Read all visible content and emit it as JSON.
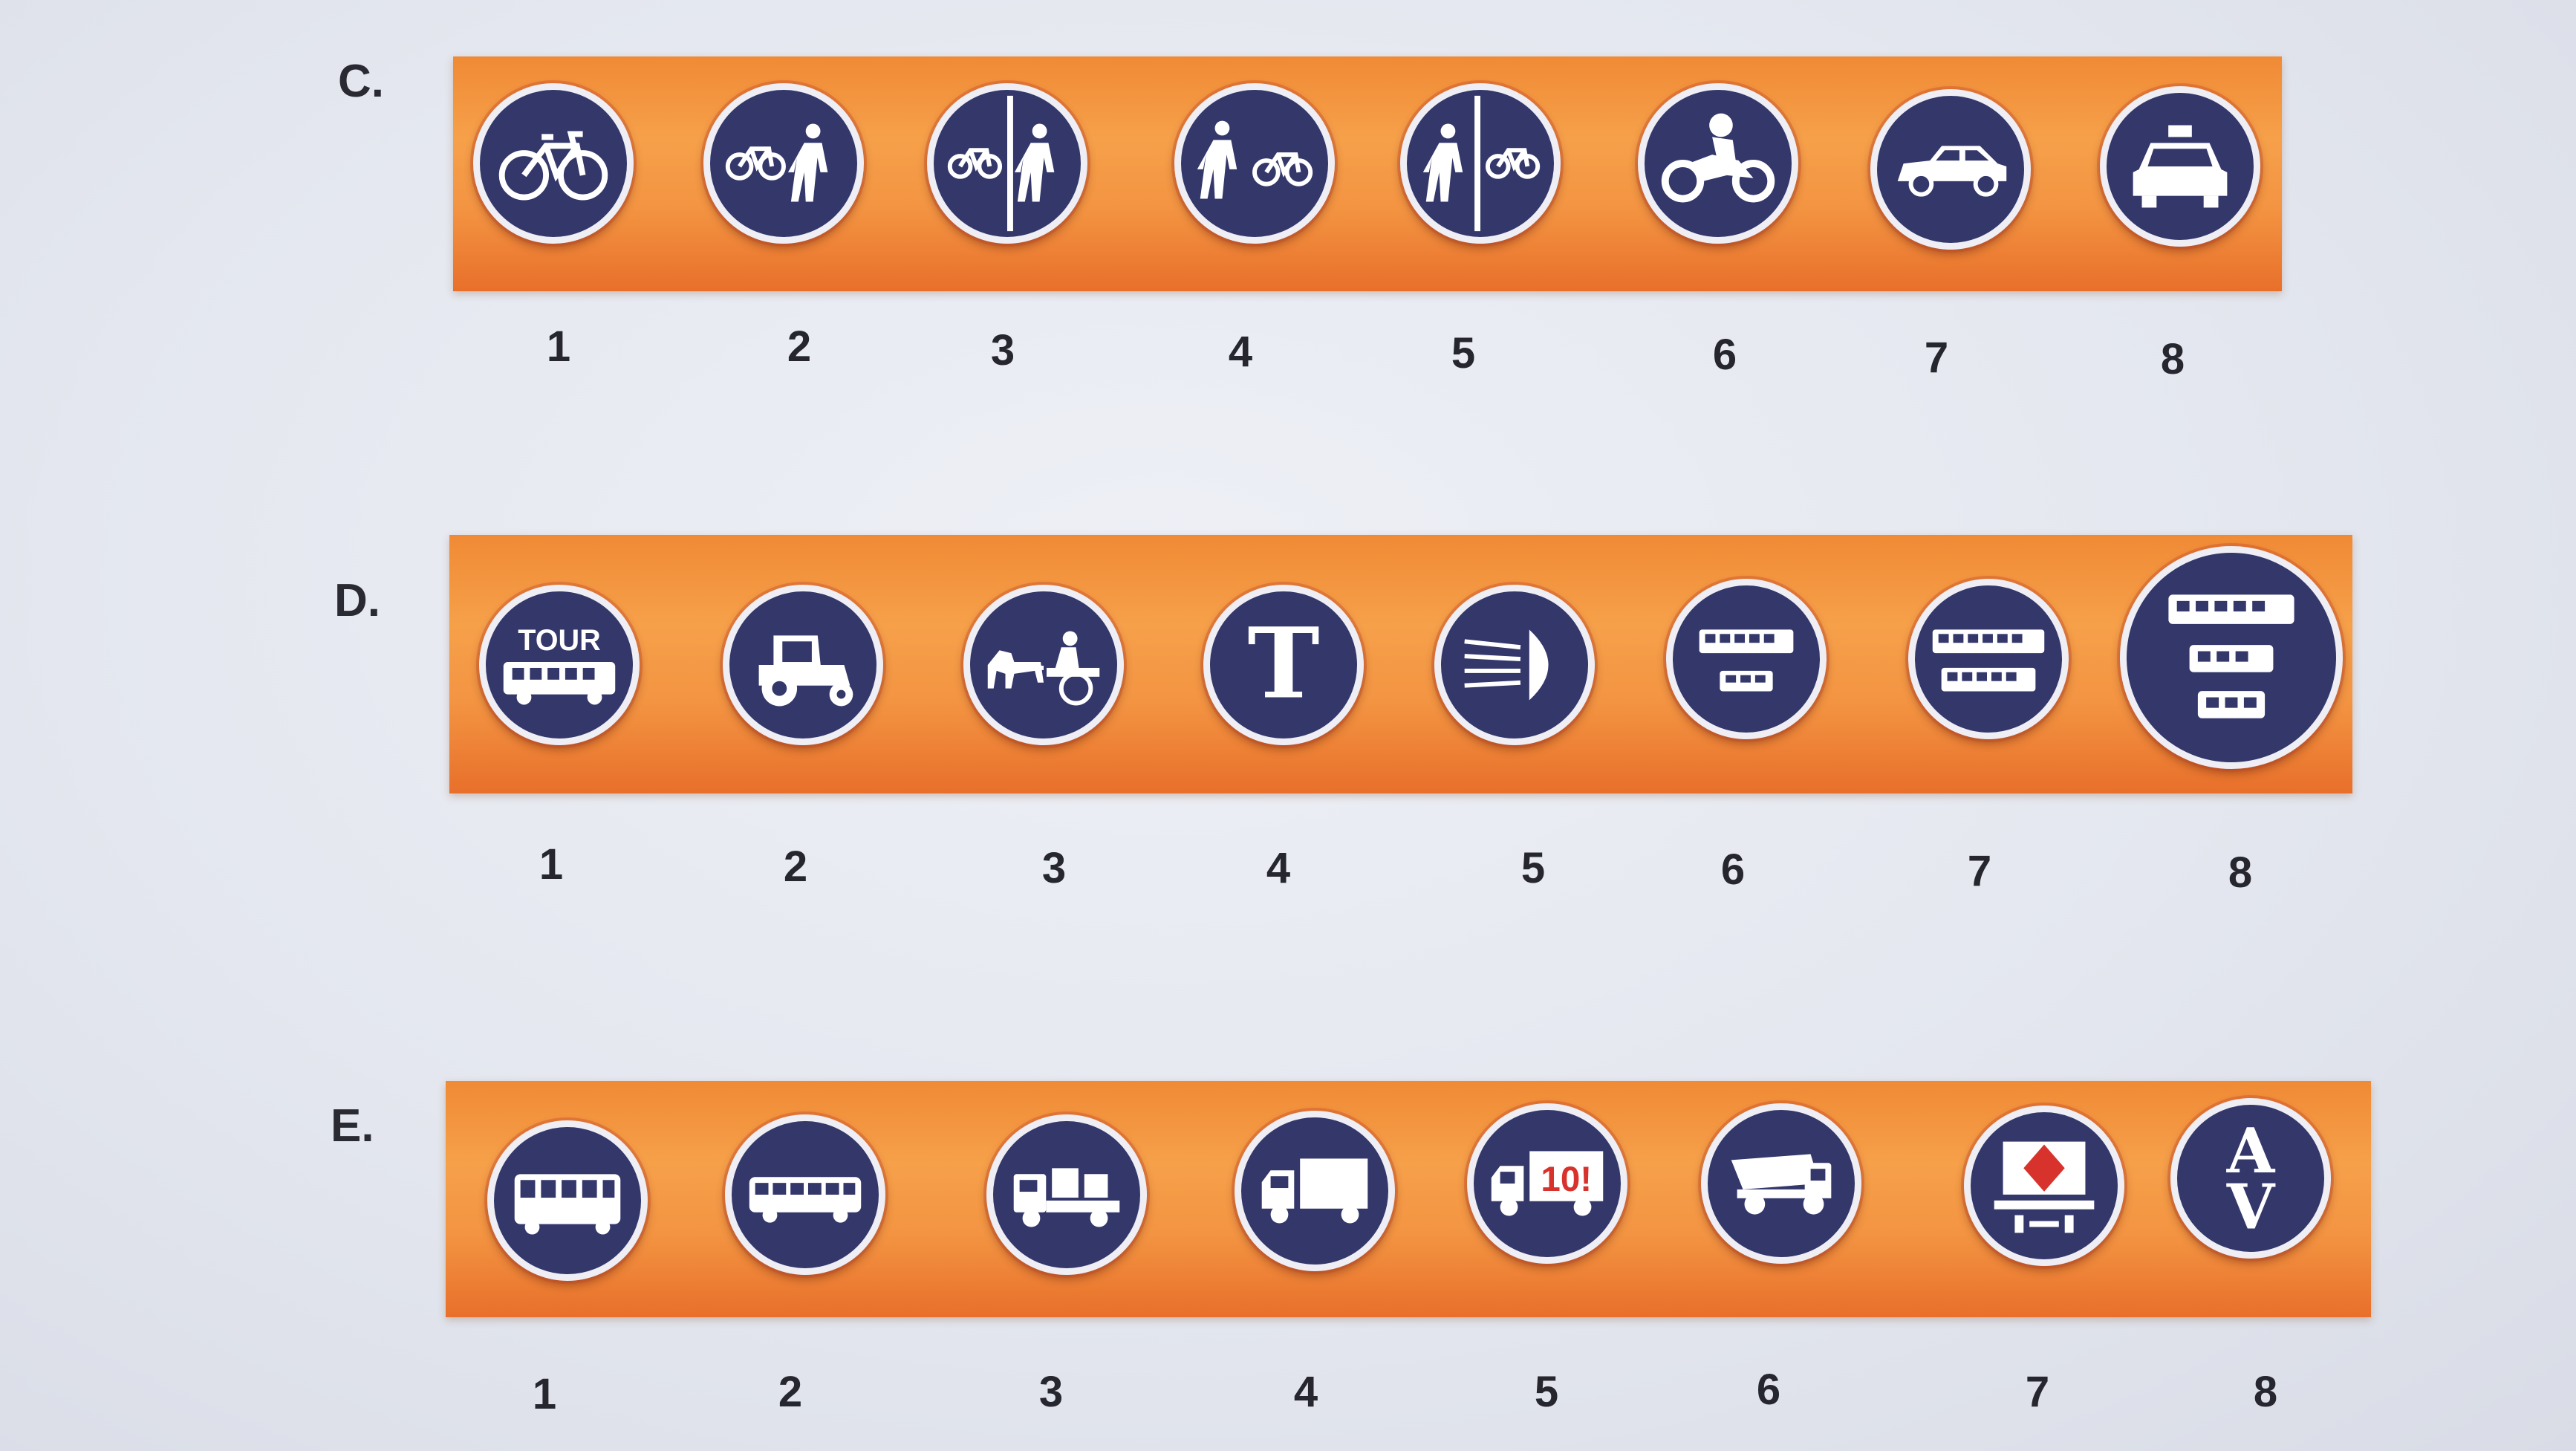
{
  "rows": [
    {
      "label": "C.",
      "signs": [
        {
          "number": "1",
          "icon": "bicycle-icon"
        },
        {
          "number": "2",
          "icon": "bicycle-pedestrian-icon"
        },
        {
          "number": "3",
          "icon": "bicycle-pedestrian-split-icon"
        },
        {
          "number": "4",
          "icon": "pedestrian-bicycle-icon"
        },
        {
          "number": "5",
          "icon": "pedestrian-bicycle-split-icon"
        },
        {
          "number": "6",
          "icon": "motorcycle-icon"
        },
        {
          "number": "7",
          "icon": "car-icon"
        },
        {
          "number": "8",
          "icon": "taxi-icon"
        }
      ]
    },
    {
      "label": "D.",
      "signs": [
        {
          "number": "1",
          "icon": "tour-bus-icon",
          "text": "TOUR"
        },
        {
          "number": "2",
          "icon": "tractor-icon"
        },
        {
          "number": "3",
          "icon": "horse-cart-icon"
        },
        {
          "number": "4",
          "icon": "tram-t-icon",
          "text": "T"
        },
        {
          "number": "5",
          "icon": "headlight-icon"
        },
        {
          "number": "6",
          "icon": "bus-minibus-icon"
        },
        {
          "number": "7",
          "icon": "bus-bus-icon"
        },
        {
          "number": "8",
          "icon": "three-buses-icon"
        }
      ]
    },
    {
      "label": "E.",
      "signs": [
        {
          "number": "1",
          "icon": "bus-front-icon"
        },
        {
          "number": "2",
          "icon": "bus-side-icon"
        },
        {
          "number": "3",
          "icon": "flatbed-truck-icon"
        },
        {
          "number": "4",
          "icon": "box-truck-icon"
        },
        {
          "number": "5",
          "icon": "truck-10t-icon",
          "text": "10!"
        },
        {
          "number": "6",
          "icon": "dump-truck-icon"
        },
        {
          "number": "7",
          "icon": "hazmat-trailer-icon"
        },
        {
          "number": "8",
          "icon": "av-icon",
          "text": "AV"
        }
      ]
    }
  ],
  "colors": {
    "sign": "#33376a",
    "strip": "#f39442",
    "border": "#eeeef4",
    "accent": "#d8322c"
  }
}
